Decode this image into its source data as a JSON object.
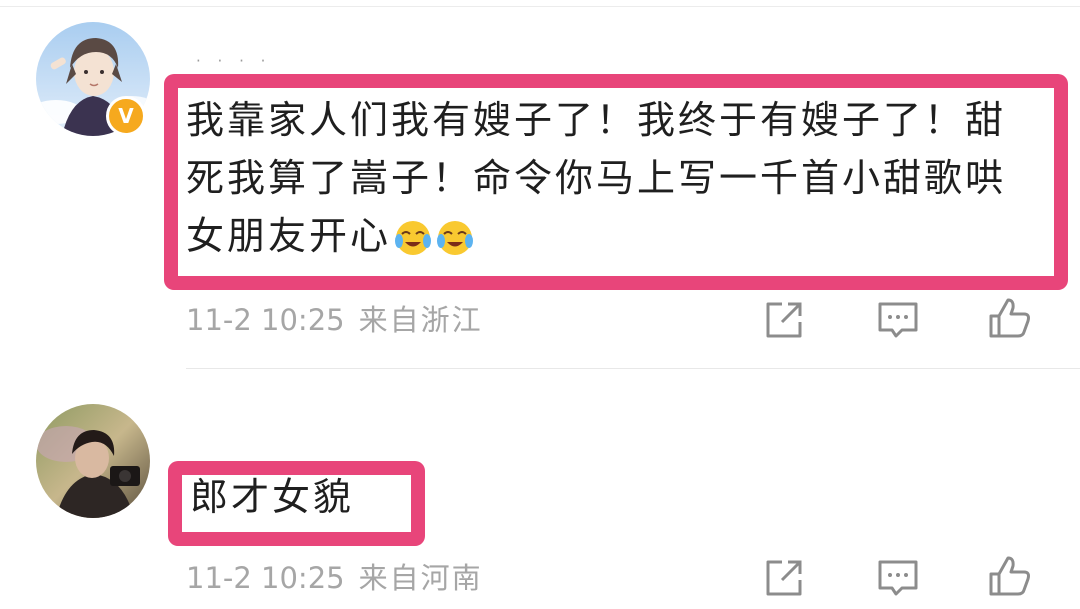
{
  "comments": [
    {
      "username": "· · · ·",
      "verified_badge": "V",
      "text": "我靠家人们我有嫂子了！我终于有嫂子了！甜死我算了嵩子！命令你马上写一千首小甜歌哄女朋友开心",
      "emojis": [
        "crying-laughing-emoji",
        "crying-laughing-emoji"
      ],
      "timestamp": "11-2 10:25",
      "source": "来自浙江",
      "actions": [
        "share-icon",
        "comment-icon",
        "like-icon"
      ]
    },
    {
      "text": "郎才女貌",
      "timestamp": "11-2 10:25",
      "source": "来自河南",
      "actions": [
        "share-icon",
        "comment-icon",
        "like-icon"
      ]
    }
  ],
  "colors": {
    "highlight": "#e8457a",
    "meta_text": "#a6a6a6",
    "verified": "#f6a91e",
    "body_text": "#1f1f1f"
  }
}
